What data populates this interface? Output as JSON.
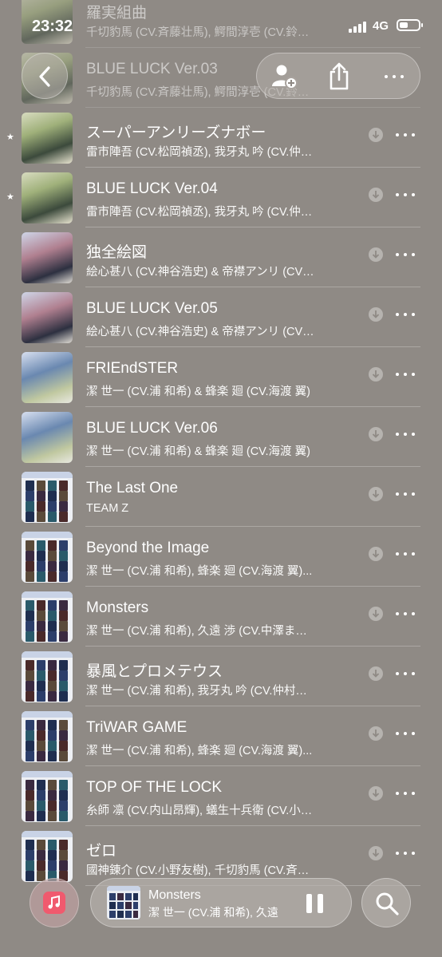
{
  "status_bar": {
    "time": "23:32",
    "network": "4G",
    "battery_level": 0.45
  },
  "toolbar": {
    "back_icon": "chevron-left-icon",
    "add_user_icon": "person-add-icon",
    "share_icon": "share-icon",
    "more_icon": "ellipsis-icon"
  },
  "tracks": [
    {
      "title": "羅実組曲",
      "artist": "千切豹馬 (CV.斉藤壮馬), 鰐間淳壱 (CV.鈴…",
      "favorite": false,
      "art": "photo",
      "faded": true
    },
    {
      "title": "BLUE LUCK Ver.03",
      "artist": "千切豹馬 (CV.斉藤壮馬), 鰐間淳壱 (CV.鈴…",
      "favorite": false,
      "art": "photo",
      "faded": true
    },
    {
      "title": "スーパーアンリーズナボー",
      "artist": "雷市陣吾 (CV.松岡禎丞), 我牙丸 吟 (CV.仲…",
      "favorite": true,
      "art": "photo"
    },
    {
      "title": "BLUE LUCK Ver.04",
      "artist": "雷市陣吾 (CV.松岡禎丞), 我牙丸 吟 (CV.仲…",
      "favorite": true,
      "art": "photo"
    },
    {
      "title": "独全絵図",
      "artist": "絵心甚八 (CV.神谷浩史) & 帝襟アンリ (CV…",
      "favorite": false,
      "art": "photo2"
    },
    {
      "title": "BLUE LUCK Ver.05",
      "artist": "絵心甚八 (CV.神谷浩史) & 帝襟アンリ (CV…",
      "favorite": false,
      "art": "photo2"
    },
    {
      "title": "FRIEndSTER",
      "artist": "潔 世一 (CV.浦 和希) & 蜂楽 廻 (CV.海渡 翼)",
      "favorite": false,
      "art": "photo3"
    },
    {
      "title": "BLUE LUCK Ver.06",
      "artist": "潔 世一 (CV.浦 和希) & 蜂楽 廻 (CV.海渡 翼)",
      "favorite": false,
      "art": "photo3"
    },
    {
      "title": "The Last One",
      "artist": "TEAM Z",
      "favorite": false,
      "art": "grid"
    },
    {
      "title": "Beyond the Image",
      "artist": "潔 世一 (CV.浦 和希), 蜂楽 廻 (CV.海渡 翼)...",
      "favorite": false,
      "art": "grid"
    },
    {
      "title": "Monsters",
      "artist": "潔 世一 (CV.浦 和希), 久遠 渉 (CV.中澤ま…",
      "favorite": false,
      "art": "grid",
      "playing": true
    },
    {
      "title": "暴風とプロメテウス",
      "artist": "潔 世一 (CV.浦 和希), 我牙丸 吟 (CV.仲村…",
      "favorite": false,
      "art": "grid"
    },
    {
      "title": "TriWAR GAME",
      "artist": "潔 世一 (CV.浦 和希), 蜂楽 廻 (CV.海渡 翼)...",
      "favorite": false,
      "art": "grid"
    },
    {
      "title": "TOP OF THE LOCK",
      "artist": "糸師 凛 (CV.内山昂輝), 蟻生十兵衛 (CV.小…",
      "favorite": false,
      "art": "grid"
    },
    {
      "title": "ゼロ",
      "artist": "國神錬介 (CV.小野友樹), 千切豹馬 (CV.斉…",
      "favorite": false,
      "art": "grid"
    }
  ],
  "now_playing": {
    "title": "Monsters",
    "artist": "潔 世一 (CV.浦 和希), 久遠",
    "state": "playing"
  },
  "bottom_icons": {
    "music": "music-note-icon",
    "pause": "pause-icon",
    "search": "search-icon"
  },
  "colors": {
    "background": "#8f8a85",
    "music_accent": "#f05a6e"
  }
}
